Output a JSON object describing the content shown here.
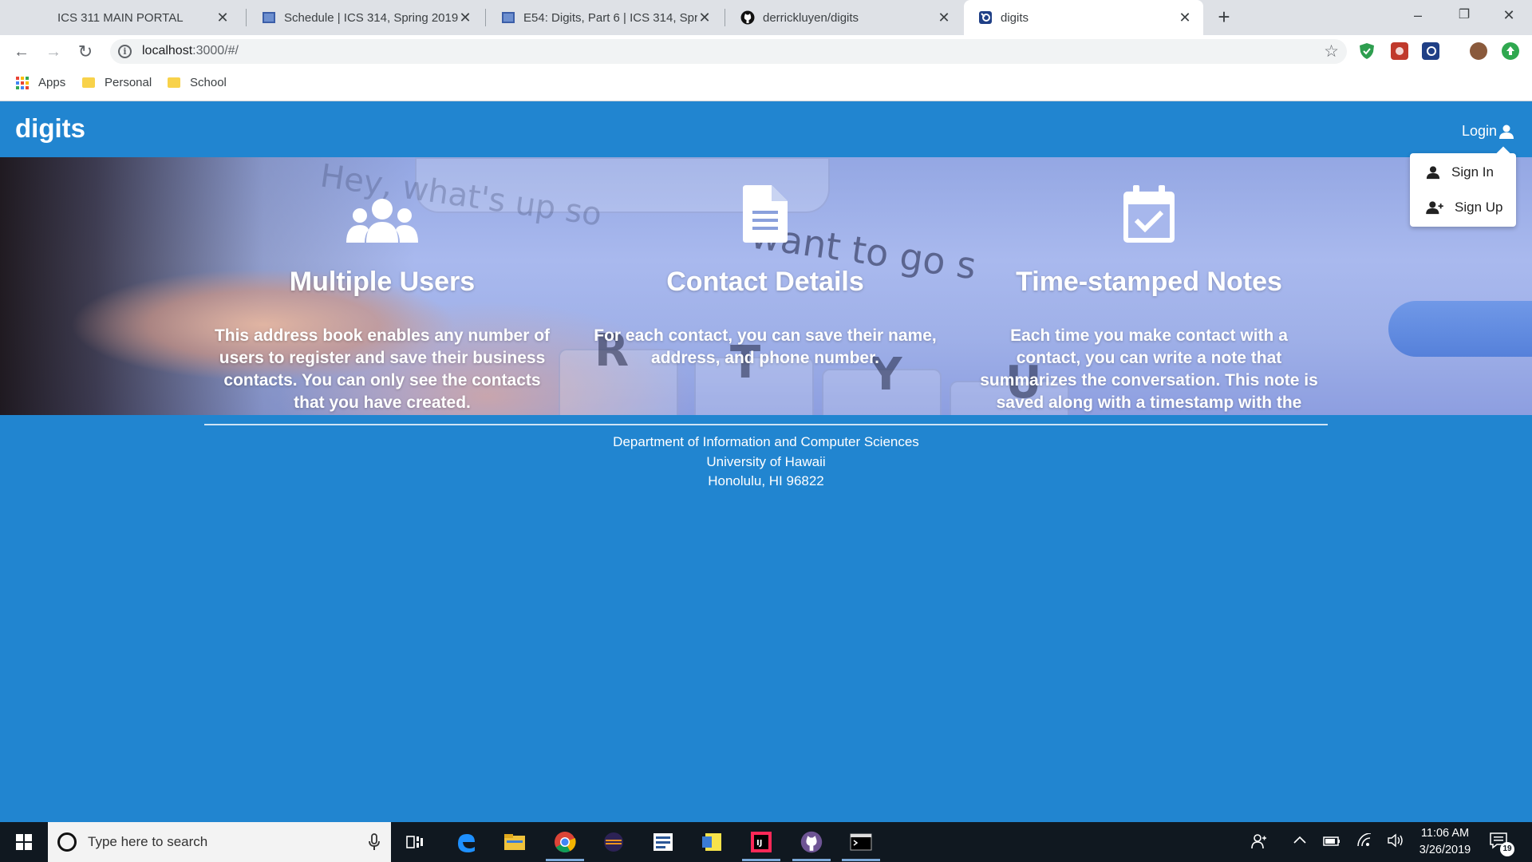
{
  "browser": {
    "tabs": [
      {
        "title": "ICS 311 MAIN PORTAL",
        "icon": "none"
      },
      {
        "title": "Schedule | ICS 314, Spring 2019",
        "icon": "page-icon"
      },
      {
        "title": "E54: Digits, Part 6 | ICS 314, Sprin",
        "icon": "page-icon"
      },
      {
        "title": "derrickluyen/digits",
        "icon": "github-icon"
      },
      {
        "title": "digits",
        "icon": "meteor-icon"
      }
    ],
    "active_tab": 4,
    "tab_close": "✕",
    "new_tab": "+",
    "window_controls": {
      "minimize": "–",
      "restore": "❐",
      "close": "✕"
    },
    "nav": {
      "back": "←",
      "forward": "→",
      "reload": "↻"
    },
    "url_host": "localhost",
    "url_rest": ":3000/#/",
    "bookmark_star": "☆",
    "bookmarks": [
      {
        "label": "Apps",
        "icon": "apps-grid-icon"
      },
      {
        "label": "Personal",
        "icon": "folder-icon"
      },
      {
        "label": "School",
        "icon": "folder-icon"
      }
    ]
  },
  "site": {
    "brand": "digits",
    "login_label": "Login",
    "dropdown": [
      {
        "label": "Sign In",
        "icon": "user-icon"
      },
      {
        "label": "Sign Up",
        "icon": "user-plus-icon"
      }
    ],
    "features": [
      {
        "title": "Multiple Users",
        "icon": "users-icon",
        "description": "This address book enables any number of users to register and save their business contacts. You can only see the contacts that you have created."
      },
      {
        "title": "Contact Details",
        "icon": "file-text-icon",
        "description": "For each contact, you can save their name, address, and phone number."
      },
      {
        "title": "Time-stamped Notes",
        "icon": "calendar-check-icon",
        "description": "Each time you make contact with a contact, you can write a note that summarizes the conversation. This note is saved along with a timestamp with the contact."
      }
    ],
    "footer": {
      "line1": "Department of Information and Computer Sciences",
      "line2": "University of Hawaii",
      "line3": "Honolulu, HI 96822"
    },
    "colors": {
      "primary": "#2185d0"
    }
  },
  "taskbar": {
    "search_placeholder": "Type here to search",
    "apps": [
      "task-view-icon",
      "edge-icon",
      "file-explorer-icon",
      "chrome-icon",
      "eclipse-icon",
      "windows-app-icon",
      "sticky-notes-icon",
      "intellij-icon",
      "github-desktop-icon",
      "terminal-icon"
    ],
    "time": "11:06 AM",
    "date": "3/26/2019",
    "notification_count": "19"
  }
}
